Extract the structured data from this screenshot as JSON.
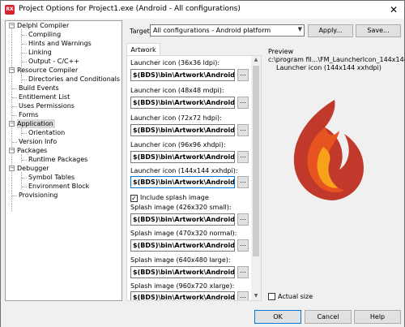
{
  "window": {
    "title": "Project Options for Project1.exe  (Android - All configurations)",
    "app_icon_text": "RX",
    "close_glyph": "✕"
  },
  "tree": {
    "items": [
      {
        "label": "Delphi Compiler",
        "expanded": true
      },
      {
        "label": "Compiling"
      },
      {
        "label": "Hints and Warnings"
      },
      {
        "label": "Linking"
      },
      {
        "label": "Output - C/C++"
      },
      {
        "label": "Resource Compiler",
        "expanded": true
      },
      {
        "label": "Directories and Conditionals"
      },
      {
        "label": "Build Events"
      },
      {
        "label": "Entitlement List"
      },
      {
        "label": "Uses Permissions"
      },
      {
        "label": "Forms"
      },
      {
        "label": "Application",
        "expanded": true,
        "selected": true
      },
      {
        "label": "Orientation"
      },
      {
        "label": "Version Info"
      },
      {
        "label": "Packages",
        "expanded": true
      },
      {
        "label": "Runtime Packages"
      },
      {
        "label": "Debugger",
        "expanded": true
      },
      {
        "label": "Symbol Tables"
      },
      {
        "label": "Environment Block"
      },
      {
        "label": "Provisioning"
      }
    ]
  },
  "target": {
    "label": "Target:",
    "value": "All configurations - Android platform",
    "apply_label": "Apply...",
    "save_label": "Save..."
  },
  "tab": {
    "label": "Artwork"
  },
  "fields": [
    {
      "label": "Launcher icon (36x36 ldpi):",
      "value": "$(BDS)\\bin\\Artwork\\Android\\FM_"
    },
    {
      "label": "Launcher icon (48x48 mdpi):",
      "value": "$(BDS)\\bin\\Artwork\\Android\\FM_"
    },
    {
      "label": "Launcher icon (72x72 hdpi):",
      "value": "$(BDS)\\bin\\Artwork\\Android\\FM_"
    },
    {
      "label": "Launcher icon (96x96 xhdpi):",
      "value": "$(BDS)\\bin\\Artwork\\Android\\FM_"
    },
    {
      "label": "Launcher icon (144x144 xxhdpi):",
      "value": "$(BDS)\\bin\\Artwork\\Android\\FM_",
      "focused": true
    }
  ],
  "splash_checkbox": {
    "label": "Include splash image",
    "checked": true
  },
  "splash_fields": [
    {
      "label": "Splash image (426x320 small):",
      "value": "$(BDS)\\bin\\Artwork\\Android\\FM_"
    },
    {
      "label": "Splash image (470x320 normal):",
      "value": "$(BDS)\\bin\\Artwork\\Android\\FM_"
    },
    {
      "label": "Splash image (640x480 large):",
      "value": "$(BDS)\\bin\\Artwork\\Android\\FM_"
    },
    {
      "label": "Splash image (960x720 xlarge):",
      "value": "$(BDS)\\bin\\Artwork\\Android\\FM_"
    }
  ],
  "browse_label": "...",
  "preview": {
    "title": "Preview",
    "path": "c:\\program fil...\\FM_LauncherIcon_144x144.png",
    "caption": "Launcher icon (144x144 xxhdpi)",
    "logo_icon": "flame-logo-icon",
    "colors": {
      "outer": "#c0392b",
      "mid": "#e8541f",
      "inner": "#f7a21a"
    }
  },
  "actual_size": {
    "label": "Actual size",
    "checked": false
  },
  "footer": {
    "ok_label": "OK",
    "cancel_label": "Cancel",
    "help_label": "Help"
  }
}
